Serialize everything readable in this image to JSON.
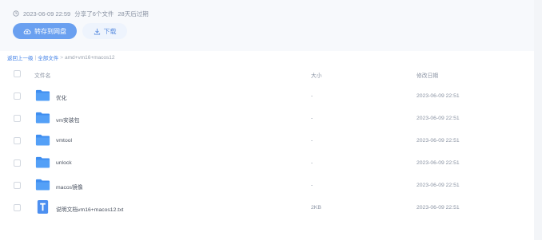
{
  "meta": {
    "datetime": "2023-06-09 22:59",
    "shared_count": "分享了6个文件",
    "expiry": "28天后过期"
  },
  "actions": {
    "save_label": "转存到网盘",
    "download_label": "下载"
  },
  "breadcrumb": {
    "back": "返回上一级",
    "divider": "|",
    "all_files": "全部文件",
    "arrow": ">",
    "current": "amd+vm16+macos12"
  },
  "table": {
    "columns": {
      "name": "文件名",
      "size": "大小",
      "date": "修改日期"
    },
    "rows": [
      {
        "name": "优化",
        "size": "-",
        "date": "2023-06-09 22:51",
        "type": "folder"
      },
      {
        "name": "vm安装包",
        "size": "-",
        "date": "2023-06-09 22:51",
        "type": "folder"
      },
      {
        "name": "vmtool",
        "size": "-",
        "date": "2023-06-09 22:51",
        "type": "folder"
      },
      {
        "name": "unlock",
        "size": "-",
        "date": "2023-06-09 22:51",
        "type": "folder"
      },
      {
        "name": "macos镜像",
        "size": "-",
        "date": "2023-06-09 22:51",
        "type": "folder"
      },
      {
        "name": "说明文档vm16+macos12.txt",
        "size": "2KB",
        "date": "2023-06-09 22:51",
        "type": "text-file"
      }
    ]
  },
  "colors": {
    "accent": "#6aa0f0",
    "folder": "#3f8ef0",
    "link": "#3d7ee6"
  },
  "icons": {
    "clock": "clock-icon",
    "save": "cloud-upload-icon",
    "download": "download-icon",
    "folder": "folder-icon",
    "text_file": "text-file-icon"
  }
}
